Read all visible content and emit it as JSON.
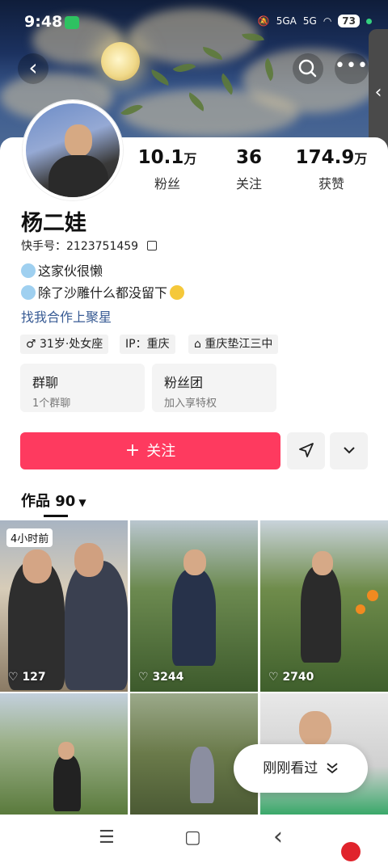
{
  "status_bar": {
    "time": "9:48",
    "signal1": "5GA",
    "signal2": "5G",
    "battery": "73"
  },
  "header": {
    "back_glyph": "‹",
    "more_glyph": "•••",
    "side_handle_glyph": "‹"
  },
  "profile": {
    "stats": [
      {
        "num": "10.1",
        "unit": "万",
        "label": "粉丝"
      },
      {
        "num": "36",
        "unit": "",
        "label": "关注"
      },
      {
        "num": "174.9",
        "unit": "万",
        "label": "获赞"
      }
    ],
    "name": "杨二娃",
    "uid_label": "快手号：",
    "uid": "2123751459",
    "bio_lines": [
      "这家伙很懒",
      "除了沙雕什么都没留下"
    ],
    "collab_link": "找我合作上聚星",
    "tags": [
      "31岁·处女座",
      "IP：重庆",
      "重庆垫江三中"
    ],
    "cards": [
      {
        "title": "群聊",
        "sub": "1个群聊"
      },
      {
        "title": "粉丝团",
        "sub": "加入享特权"
      }
    ]
  },
  "actions": {
    "follow": "关注"
  },
  "works": {
    "tab_label": "作品",
    "count": "90",
    "recent_badge": "4小时前",
    "likes": [
      "127",
      "3244",
      "2740"
    ]
  },
  "recent_pill": "刚刚看过",
  "navbar": {
    "menu": "☰",
    "home": "▢",
    "back": "‹"
  }
}
